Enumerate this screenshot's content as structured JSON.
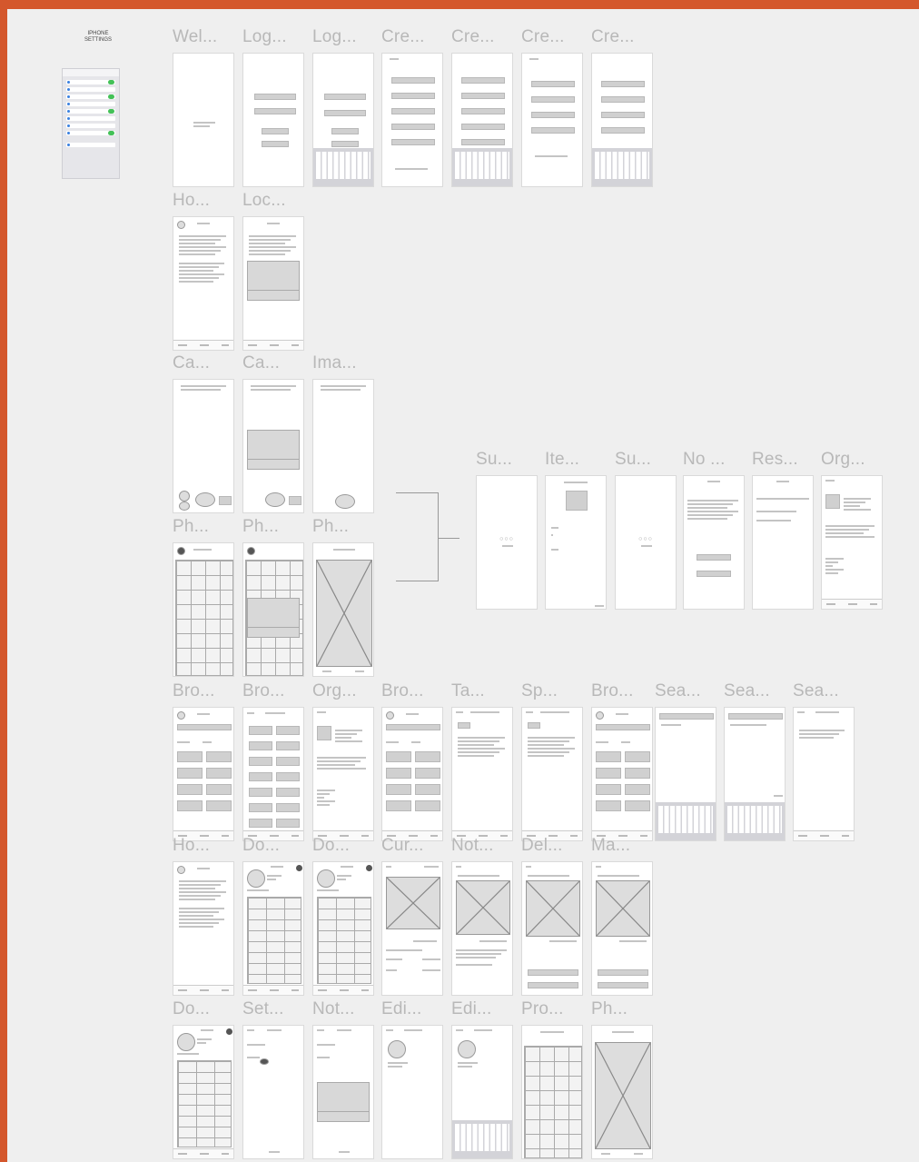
{
  "canvas": {
    "background": "#efefef",
    "accent": "#d4572c",
    "sidebar_title": "IPHONE\nSETTINGS"
  },
  "frames": [
    {
      "key": "welcome",
      "label": "Wel..."
    },
    {
      "key": "login1",
      "label": "Log..."
    },
    {
      "key": "login2",
      "label": "Log..."
    },
    {
      "key": "create1",
      "label": "Cre..."
    },
    {
      "key": "create2",
      "label": "Cre..."
    },
    {
      "key": "create3",
      "label": "Cre..."
    },
    {
      "key": "create4",
      "label": "Cre..."
    },
    {
      "key": "home1",
      "label": "Ho..."
    },
    {
      "key": "location",
      "label": "Loc..."
    },
    {
      "key": "camera1",
      "label": "Ca..."
    },
    {
      "key": "camera2",
      "label": "Ca..."
    },
    {
      "key": "image",
      "label": "Ima..."
    },
    {
      "key": "photo1",
      "label": "Ph..."
    },
    {
      "key": "photo2",
      "label": "Ph..."
    },
    {
      "key": "photo3",
      "label": "Ph..."
    },
    {
      "key": "submit1",
      "label": "Su..."
    },
    {
      "key": "item",
      "label": "Ite..."
    },
    {
      "key": "submit2",
      "label": "Su..."
    },
    {
      "key": "noresults",
      "label": "No ..."
    },
    {
      "key": "results",
      "label": "Res..."
    },
    {
      "key": "org1",
      "label": "Org..."
    },
    {
      "key": "browse1",
      "label": "Bro..."
    },
    {
      "key": "browse2",
      "label": "Bro..."
    },
    {
      "key": "org2",
      "label": "Org..."
    },
    {
      "key": "browse3",
      "label": "Bro..."
    },
    {
      "key": "tab",
      "label": "Ta..."
    },
    {
      "key": "specify",
      "label": "Sp..."
    },
    {
      "key": "browse4",
      "label": "Bro..."
    },
    {
      "key": "search1",
      "label": "Sea..."
    },
    {
      "key": "search2",
      "label": "Sea..."
    },
    {
      "key": "search3",
      "label": "Sea..."
    },
    {
      "key": "home2",
      "label": "Ho..."
    },
    {
      "key": "donate1",
      "label": "Do..."
    },
    {
      "key": "donate2",
      "label": "Do..."
    },
    {
      "key": "current",
      "label": "Cur..."
    },
    {
      "key": "notif1",
      "label": "Not..."
    },
    {
      "key": "delete",
      "label": "Del..."
    },
    {
      "key": "manage",
      "label": "Ma..."
    },
    {
      "key": "donate3",
      "label": "Do..."
    },
    {
      "key": "settings",
      "label": "Set..."
    },
    {
      "key": "notif2",
      "label": "Not..."
    },
    {
      "key": "edit1",
      "label": "Edi..."
    },
    {
      "key": "edit2",
      "label": "Edi..."
    },
    {
      "key": "profile",
      "label": "Pro..."
    },
    {
      "key": "photo4",
      "label": "Ph..."
    }
  ]
}
